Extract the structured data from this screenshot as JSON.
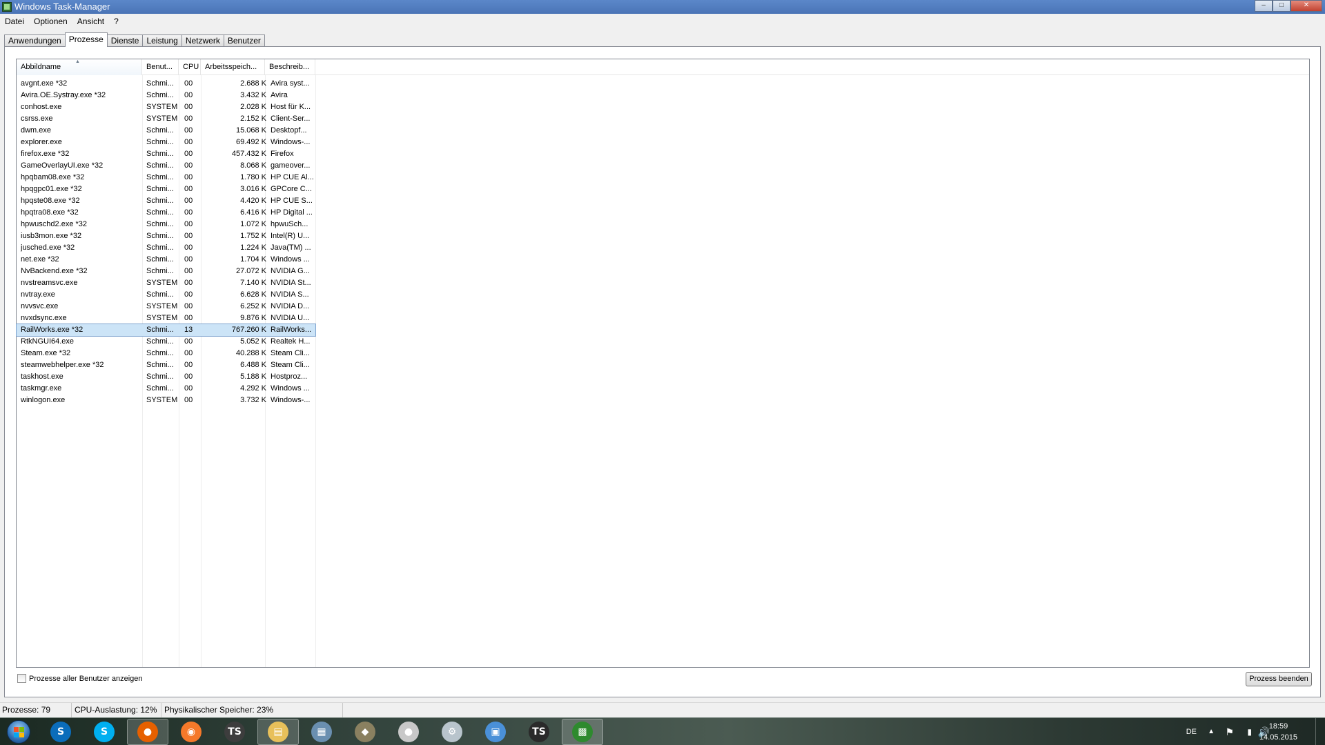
{
  "window": {
    "title": "Windows Task-Manager",
    "minimize": "–",
    "maximize": "□",
    "close": "✕"
  },
  "menu": [
    "Datei",
    "Optionen",
    "Ansicht",
    "?"
  ],
  "tabs": [
    {
      "label": "Anwendungen",
      "active": false
    },
    {
      "label": "Prozesse",
      "active": true
    },
    {
      "label": "Dienste",
      "active": false
    },
    {
      "label": "Leistung",
      "active": false
    },
    {
      "label": "Netzwerk",
      "active": false
    },
    {
      "label": "Benutzer",
      "active": false
    }
  ],
  "columns": {
    "name": "Abbildname",
    "user": "Benut...",
    "cpu": "CPU",
    "mem": "Arbeitsspeich...",
    "desc": "Beschreib..."
  },
  "processes": [
    {
      "name": "avgnt.exe *32",
      "user": "Schmi...",
      "cpu": "00",
      "mem": "2.688 K",
      "desc": "Avira syst..."
    },
    {
      "name": "Avira.OE.Systray.exe *32",
      "user": "Schmi...",
      "cpu": "00",
      "mem": "3.432 K",
      "desc": "Avira"
    },
    {
      "name": "conhost.exe",
      "user": "SYSTEM",
      "cpu": "00",
      "mem": "2.028 K",
      "desc": "Host für K..."
    },
    {
      "name": "csrss.exe",
      "user": "SYSTEM",
      "cpu": "00",
      "mem": "2.152 K",
      "desc": "Client-Ser..."
    },
    {
      "name": "dwm.exe",
      "user": "Schmi...",
      "cpu": "00",
      "mem": "15.068 K",
      "desc": "Desktopf..."
    },
    {
      "name": "explorer.exe",
      "user": "Schmi...",
      "cpu": "00",
      "mem": "69.492 K",
      "desc": "Windows-..."
    },
    {
      "name": "firefox.exe *32",
      "user": "Schmi...",
      "cpu": "00",
      "mem": "457.432 K",
      "desc": "Firefox"
    },
    {
      "name": "GameOverlayUI.exe *32",
      "user": "Schmi...",
      "cpu": "00",
      "mem": "8.068 K",
      "desc": "gameover..."
    },
    {
      "name": "hpqbam08.exe *32",
      "user": "Schmi...",
      "cpu": "00",
      "mem": "1.780 K",
      "desc": "HP CUE Al..."
    },
    {
      "name": "hpqgpc01.exe *32",
      "user": "Schmi...",
      "cpu": "00",
      "mem": "3.016 K",
      "desc": "GPCore C..."
    },
    {
      "name": "hpqste08.exe *32",
      "user": "Schmi...",
      "cpu": "00",
      "mem": "4.420 K",
      "desc": "HP CUE S..."
    },
    {
      "name": "hpqtra08.exe *32",
      "user": "Schmi...",
      "cpu": "00",
      "mem": "6.416 K",
      "desc": "HP Digital ..."
    },
    {
      "name": "hpwuschd2.exe *32",
      "user": "Schmi...",
      "cpu": "00",
      "mem": "1.072 K",
      "desc": "hpwuSch..."
    },
    {
      "name": "iusb3mon.exe *32",
      "user": "Schmi...",
      "cpu": "00",
      "mem": "1.752 K",
      "desc": "Intel(R) U..."
    },
    {
      "name": "jusched.exe *32",
      "user": "Schmi...",
      "cpu": "00",
      "mem": "1.224 K",
      "desc": "Java(TM) ..."
    },
    {
      "name": "net.exe *32",
      "user": "Schmi...",
      "cpu": "00",
      "mem": "1.704 K",
      "desc": "Windows ..."
    },
    {
      "name": "NvBackend.exe *32",
      "user": "Schmi...",
      "cpu": "00",
      "mem": "27.072 K",
      "desc": "NVIDIA G..."
    },
    {
      "name": "nvstreamsvc.exe",
      "user": "SYSTEM",
      "cpu": "00",
      "mem": "7.140 K",
      "desc": "NVIDIA St..."
    },
    {
      "name": "nvtray.exe",
      "user": "Schmi...",
      "cpu": "00",
      "mem": "6.628 K",
      "desc": "NVIDIA S..."
    },
    {
      "name": "nvvsvc.exe",
      "user": "SYSTEM",
      "cpu": "00",
      "mem": "6.252 K",
      "desc": "NVIDIA D..."
    },
    {
      "name": "nvxdsync.exe",
      "user": "SYSTEM",
      "cpu": "00",
      "mem": "9.876 K",
      "desc": "NVIDIA U..."
    },
    {
      "name": "RailWorks.exe *32",
      "user": "Schmi...",
      "cpu": "13",
      "mem": "767.260 K",
      "desc": "RailWorks...",
      "selected": true
    },
    {
      "name": "RtkNGUI64.exe",
      "user": "Schmi...",
      "cpu": "00",
      "mem": "5.052 K",
      "desc": "Realtek H..."
    },
    {
      "name": "Steam.exe *32",
      "user": "Schmi...",
      "cpu": "00",
      "mem": "40.288 K",
      "desc": "Steam Cli..."
    },
    {
      "name": "steamwebhelper.exe *32",
      "user": "Schmi...",
      "cpu": "00",
      "mem": "6.488 K",
      "desc": "Steam Cli..."
    },
    {
      "name": "taskhost.exe",
      "user": "Schmi...",
      "cpu": "00",
      "mem": "5.188 K",
      "desc": "Hostproz..."
    },
    {
      "name": "taskmgr.exe",
      "user": "Schmi...",
      "cpu": "00",
      "mem": "4.292 K",
      "desc": "Windows ..."
    },
    {
      "name": "winlogon.exe",
      "user": "SYSTEM",
      "cpu": "00",
      "mem": "3.732 K",
      "desc": "Windows-..."
    }
  ],
  "show_all_users": {
    "label": "Prozesse aller Benutzer anzeigen",
    "checked": false
  },
  "end_process_button": "Prozess beenden",
  "status": {
    "processes": "Prozesse: 79",
    "cpu": "CPU-Auslastung: 12%",
    "memory": "Physikalischer Speicher: 23%"
  },
  "taskbar": {
    "apps": [
      {
        "icon": "skype-status-icon",
        "glyph": "S",
        "color": "#0b6dbb",
        "active": false
      },
      {
        "icon": "skype-icon",
        "glyph": "S",
        "color": "#00aff0",
        "active": false
      },
      {
        "icon": "firefox-icon",
        "glyph": "●",
        "color": "#e66000",
        "active": true
      },
      {
        "icon": "blender-icon",
        "glyph": "◉",
        "color": "#f5792a",
        "active": false
      },
      {
        "icon": "teamspeak-icon",
        "glyph": "TS",
        "color": "#3d3d3d",
        "active": false
      },
      {
        "icon": "explorer-folder-icon",
        "glyph": "▤",
        "color": "#e8c05a",
        "active": true
      },
      {
        "icon": "railworks-icon",
        "glyph": "▦",
        "color": "#6a8fb0",
        "active": false
      },
      {
        "icon": "tank-game-icon",
        "glyph": "◆",
        "color": "#8a8060",
        "active": false
      },
      {
        "icon": "disc-app-icon",
        "glyph": "●",
        "color": "#c8c8c8",
        "active": false
      },
      {
        "icon": "steam-settings-icon",
        "glyph": "⚙",
        "color": "#b8c4cc",
        "active": false
      },
      {
        "icon": "control-panel-icon",
        "glyph": "▣",
        "color": "#4a90d8",
        "active": false
      },
      {
        "icon": "teamspeak-client-icon",
        "glyph": "TS",
        "color": "#2a2a2a",
        "active": false
      },
      {
        "icon": "task-manager-icon",
        "glyph": "▩",
        "color": "#2e8a2e",
        "active": true
      }
    ],
    "language": "DE",
    "time": "18:59",
    "date": "14.05.2015"
  }
}
